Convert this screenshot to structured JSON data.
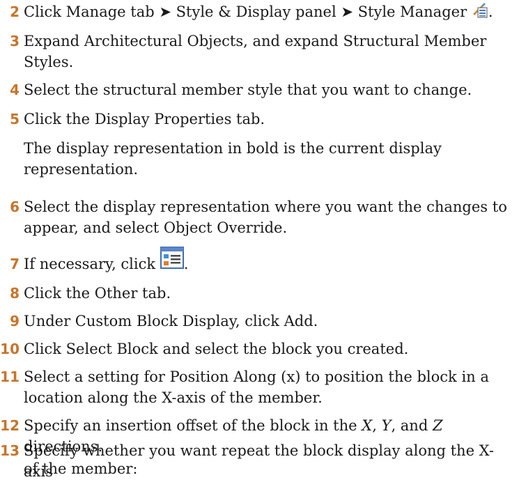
{
  "steps": [
    {
      "num": "2",
      "text_a": "Click Manage tab ➤ Style & Display panel ➤ Style Manager",
      "text_b": "."
    },
    {
      "num": "3",
      "line1": "Expand Architectural Objects, and expand Structural Member",
      "line2": "Styles."
    },
    {
      "num": "4",
      "text": "Select the structural member style that you want to change."
    },
    {
      "num": "5",
      "text": "Click the Display Properties tab."
    },
    {
      "num": "6",
      "line1": "Select the display representation where you want the changes to",
      "line2": "appear, and select Object Override."
    },
    {
      "num": "7",
      "text_a": "If necessary, click",
      "text_b": "."
    },
    {
      "num": "8",
      "text": "Click the Other tab."
    },
    {
      "num": "9",
      "text": "Under Custom Block Display, click Add."
    },
    {
      "num": "10",
      "text": "Click Select Block and select the block you created."
    },
    {
      "num": "11",
      "line1": "Select a setting for Position Along (x) to position the block in a",
      "line2": "location along the X-axis of the member."
    },
    {
      "num": "12",
      "part1": "Specify an insertion offset of the block in the ",
      "x": "X",
      "part2": ", ",
      "y": "Y",
      "part3": ", and ",
      "z": "Z",
      "part4": " directions."
    },
    {
      "num": "13",
      "line1": "Specify whether you want repeat the block display along the X-axis",
      "line2": "of the member:"
    }
  ],
  "note": {
    "line1": "The display representation in bold is the current display",
    "line2": "representation."
  },
  "icons": {
    "style_manager": "style-manager-icon",
    "display_properties": "display-properties-icon"
  }
}
